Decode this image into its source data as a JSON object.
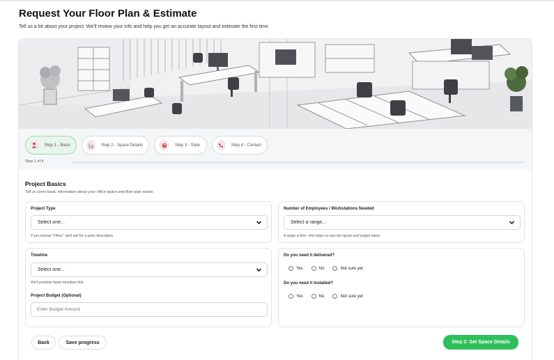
{
  "page": {
    "title": "Request Your Floor Plan & Estimate",
    "subtitle": "Tell us a bit about your project. We'll review your info and help you get an accurate layout and estimate the first time."
  },
  "steps": [
    {
      "label": "Step 1 - Basic",
      "icon": "person-icon",
      "active": true
    },
    {
      "label": "Step 2 - Space Details",
      "icon": "floorplan-icon",
      "active": false
    },
    {
      "label": "Step 3 - Style",
      "icon": "palette-icon",
      "active": false
    },
    {
      "label": "Step 4 - Contact",
      "icon": "phone-icon",
      "active": false
    }
  ],
  "progress": {
    "label": "Step 1 of 4",
    "fraction": 0.25
  },
  "section": {
    "title": "Project Basics",
    "subtitle": "Tell us some basic information about your office space and floor plan needs."
  },
  "fields": {
    "project_type": {
      "label": "Project Type",
      "value": "Select one...",
      "help": "If you choose \"Other,\" we'll ask for a quick description."
    },
    "employees": {
      "label": "Number of Employees / Workstations Needed",
      "value": "Select a range...",
      "help": "A range is fine—this helps us size the layout and budget faster."
    },
    "timeline": {
      "label": "Timeline",
      "value": "Select one...",
      "help": "We'll prioritize faster timelines first."
    },
    "budget": {
      "label": "Project Budget (Optional)",
      "placeholder": "Enter Budget Amount"
    },
    "delivered": {
      "label": "Do you need it delivered?",
      "options": [
        "Yes",
        "No",
        "Not sure yet"
      ]
    },
    "installed": {
      "label": "Do you need it installed?",
      "options": [
        "Yes",
        "No",
        "Not sure yet"
      ]
    }
  },
  "actions": {
    "back": "Back",
    "save": "Save progress",
    "next": "Step 2: Set Space Details"
  },
  "colors": {
    "primary": "#2fbf5a",
    "active_step_bg": "#e8f5ec",
    "step_icon_bg": "#f3e6ea"
  }
}
